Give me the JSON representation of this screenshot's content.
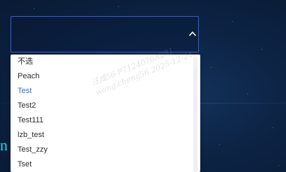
{
  "select": {
    "value": "",
    "icon": "chevron-up-icon"
  },
  "dropdown": {
    "options": [
      {
        "label": "不选",
        "selected": false
      },
      {
        "label": "Peach",
        "selected": false
      },
      {
        "label": "Test",
        "selected": true
      },
      {
        "label": "Test2",
        "selected": false
      },
      {
        "label": "Test111",
        "selected": false
      },
      {
        "label": "lzb_test",
        "selected": false
      },
      {
        "label": "Test_zzy",
        "selected": false
      },
      {
        "label": "Tset",
        "selected": false
      }
    ]
  },
  "background": {
    "edge_text": "n"
  },
  "watermark": {
    "line1": "汪成56 P7124076A281",
    "line2": "wang.cheng56 2025-12-24"
  },
  "colors": {
    "accent": "#2f6fd9",
    "select_border": "#3b5bd6",
    "edge_text": "#27d3e8"
  }
}
